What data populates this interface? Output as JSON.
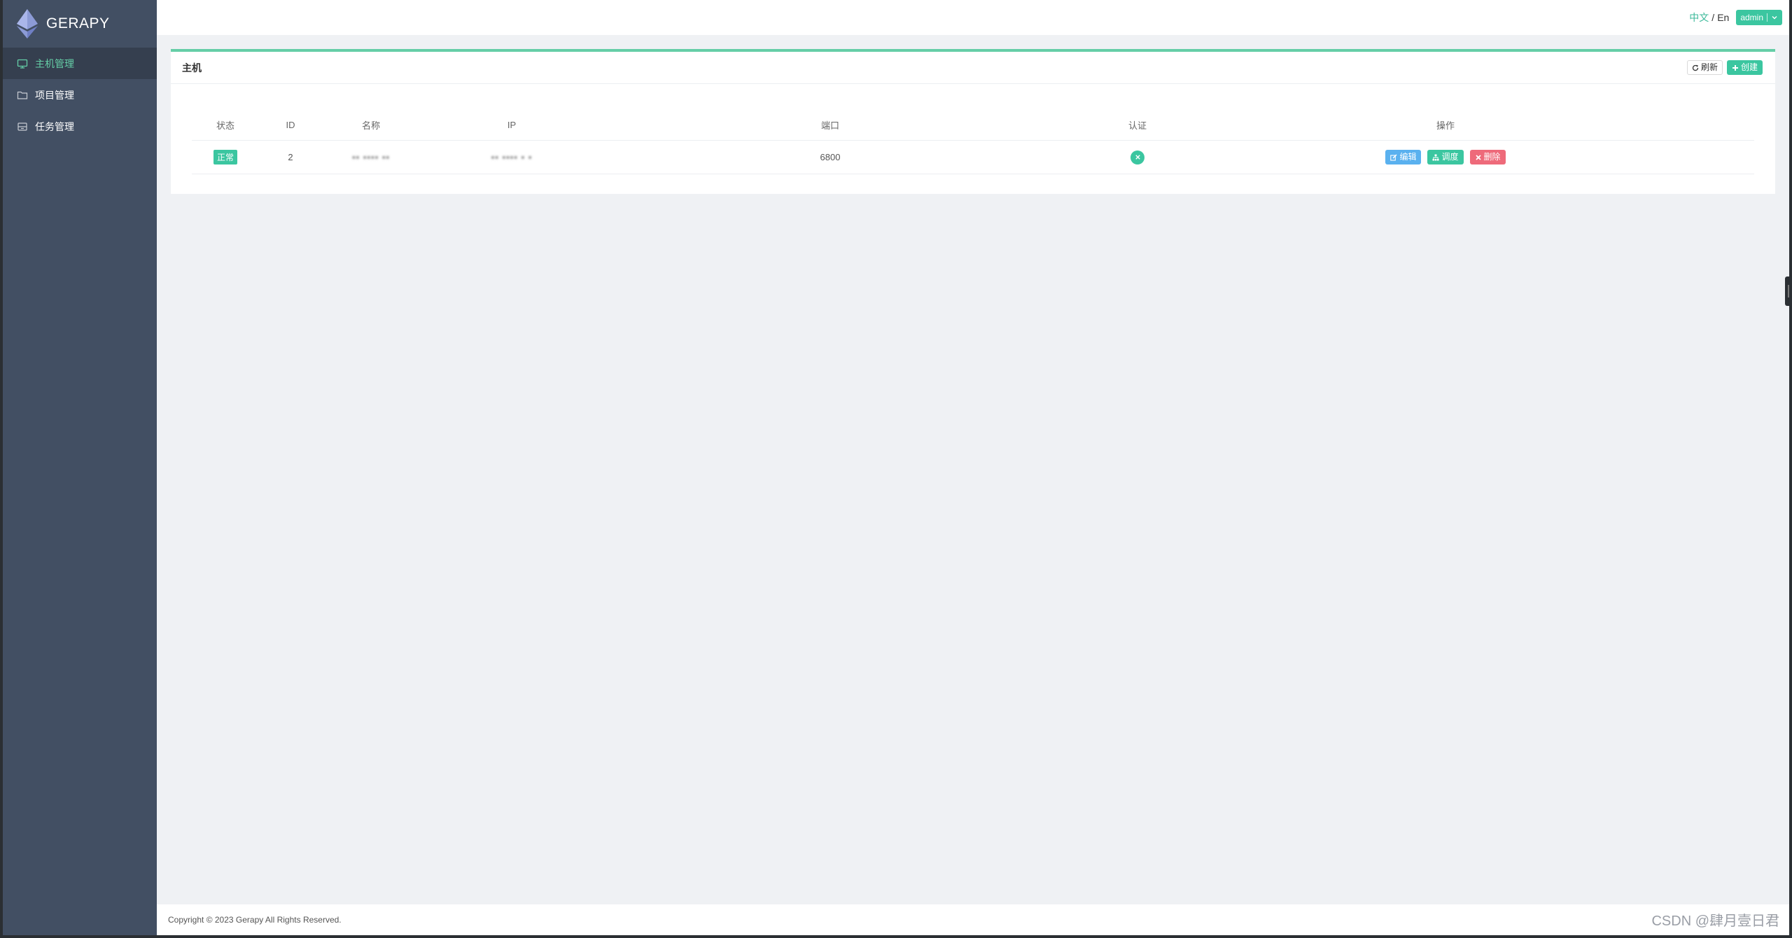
{
  "brand": {
    "name": "GERAPY"
  },
  "sidebar": {
    "items": [
      {
        "label": "主机管理",
        "icon": "monitor-icon",
        "active": true
      },
      {
        "label": "项目管理",
        "icon": "folder-icon",
        "active": false
      },
      {
        "label": "任务管理",
        "icon": "task-icon",
        "active": false
      }
    ]
  },
  "header": {
    "lang_zh": "中文",
    "lang_sep": "/",
    "lang_en": "En",
    "user": "admin"
  },
  "panel": {
    "title": "主机",
    "refresh_label": "刷新",
    "create_label": "创建"
  },
  "table": {
    "columns": [
      "状态",
      "ID",
      "名称",
      "IP",
      "端口",
      "认证",
      "操作"
    ],
    "rows": [
      {
        "status": "正常",
        "id": "2",
        "name": "▪▪ ▪▪▪▪ ▪▪",
        "ip": "▪▪  ▪▪▪▪ ▪ ▪",
        "port": "6800",
        "auth": "x-icon",
        "actions": {
          "edit": "编辑",
          "schedule": "调度",
          "delete": "删除"
        }
      }
    ]
  },
  "footer": {
    "copyright": "Copyright © 2023 Gerapy All Rights Reserved."
  },
  "watermark": "CSDN @肆月壹日君",
  "colors": {
    "sidebar": "#424f63",
    "accent": "#3bc6a0",
    "blue": "#5ab1ef",
    "red": "#ee6a7a"
  }
}
